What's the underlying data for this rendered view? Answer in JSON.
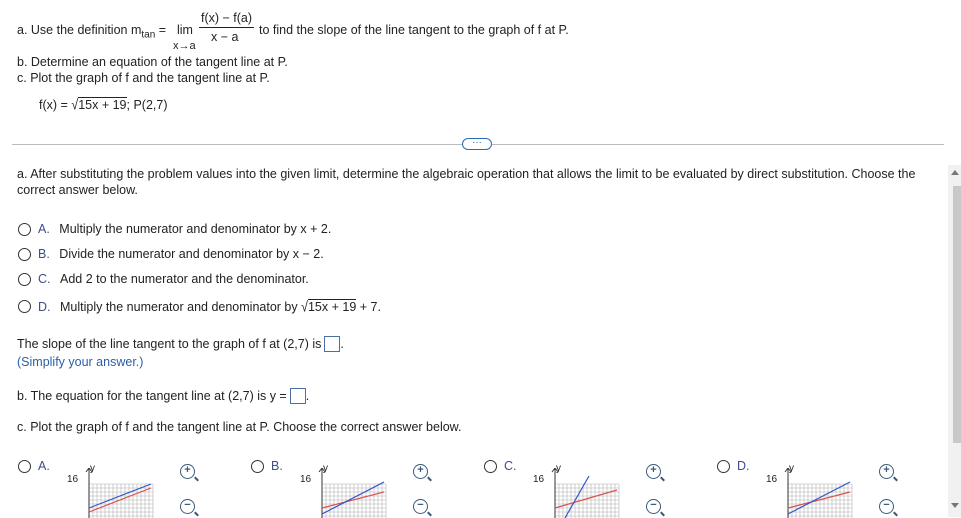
{
  "problem": {
    "a_prefix": "a. Use the definition m",
    "a_sub": "tan",
    "a_eq": "=",
    "lim": "lim",
    "lim_sub": "x→a",
    "frac_num": "f(x) − f(a)",
    "frac_den": "x − a",
    "a_suffix": "to find the slope of the line tangent to the graph of f at P.",
    "b": "b. Determine an equation of the tangent line at P.",
    "c": "c. Plot the graph of f and the tangent line at P.",
    "func_prefix": "f(x) =",
    "func_radicand": "15x + 19",
    "func_suffix": "; P(2,7)"
  },
  "more_button": "···",
  "question_a": "a. After substituting the problem values into the given limit, determine the algebraic operation that allows the limit to be evaluated by direct substitution. Choose the correct answer below.",
  "options": [
    {
      "letter": "A.",
      "text": "Multiply the numerator and denominator by x + 2."
    },
    {
      "letter": "B.",
      "text": "Divide the numerator and denominator by x − 2."
    },
    {
      "letter": "C.",
      "text": "Add 2 to the numerator and the denominator."
    },
    {
      "letter": "D.",
      "text": "Multiply the numerator and denominator by",
      "radicand": "15x + 19",
      "suffix": "+ 7."
    }
  ],
  "slope_prompt": "The slope of the line tangent to the graph of f at (2,7) is",
  "slope_value": "",
  "simplify_hint": "(Simplify your answer.)",
  "tangent_prompt": "b. The equation for the tangent line at (2,7) is y =",
  "tangent_value": "",
  "plot_prompt": "c. Plot the graph of f and the tangent line at P. Choose the correct answer below.",
  "graph_choices": [
    {
      "letter": "A.",
      "y_axis": "y",
      "y_tick": "16"
    },
    {
      "letter": "B.",
      "y_axis": "y",
      "y_tick": "16"
    },
    {
      "letter": "C.",
      "y_axis": "y",
      "y_tick": "16"
    },
    {
      "letter": "D.",
      "y_axis": "y",
      "y_tick": "16"
    }
  ],
  "colors": {
    "curve": "#d9534f",
    "tangent": "#3355cc",
    "grid": "#b0b0b0",
    "link": "#2a60a8"
  },
  "icons": [
    "zoom-in-icon",
    "zoom-out-icon"
  ]
}
